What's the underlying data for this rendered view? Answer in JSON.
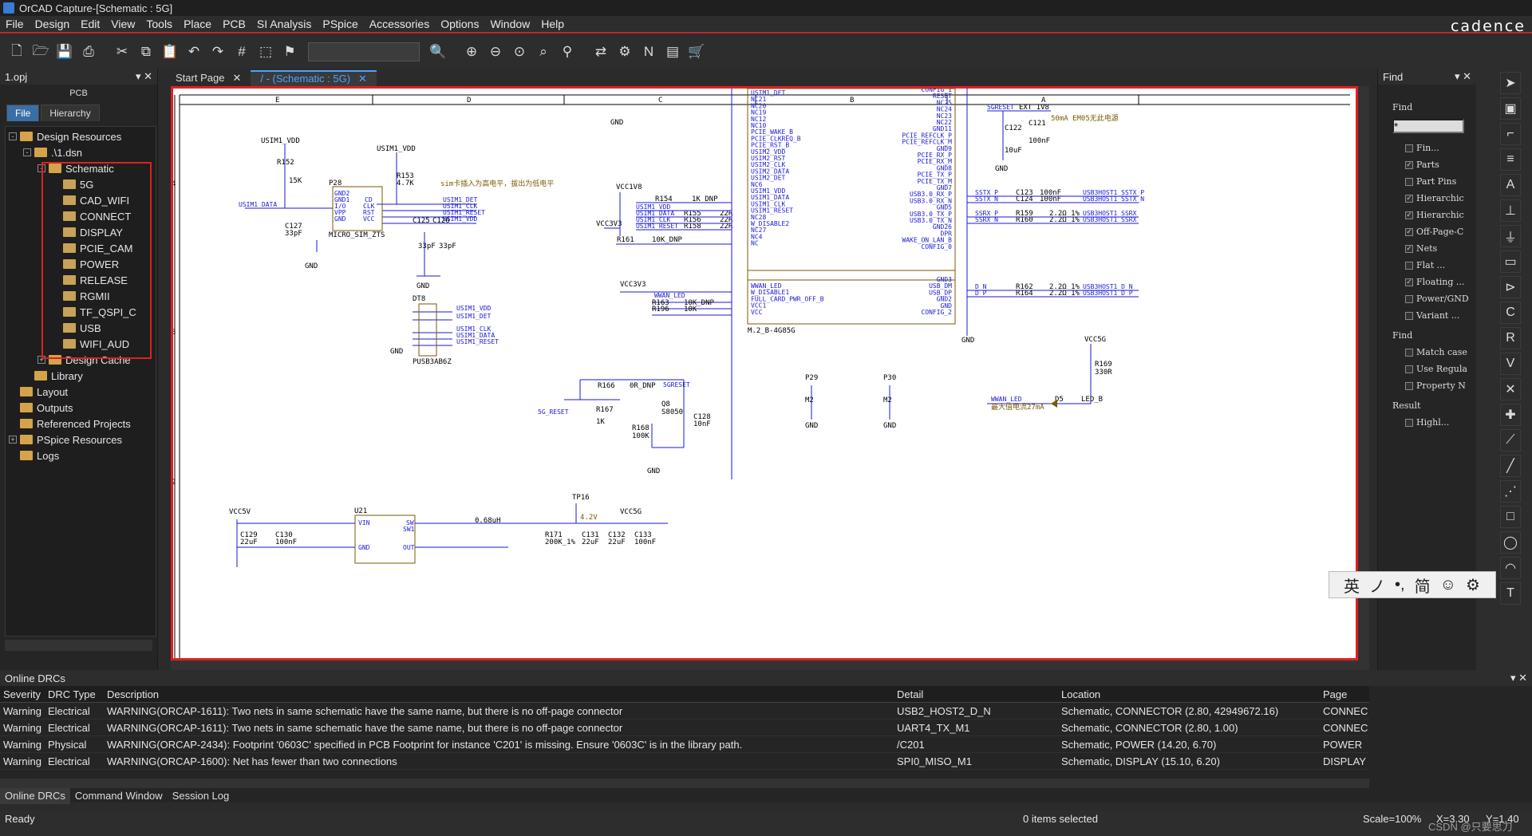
{
  "window": {
    "title": "OrCAD Capture-[Schematic : 5G]",
    "brand": "cadence"
  },
  "menu": [
    "File",
    "Design",
    "Edit",
    "View",
    "Tools",
    "Place",
    "PCB",
    "SI Analysis",
    "PSpice",
    "Accessories",
    "Options",
    "Window",
    "Help"
  ],
  "left_panel": {
    "title": "1.opj",
    "subtitle": "PCB",
    "tabs": [
      "File",
      "Hierarchy"
    ],
    "tree": [
      {
        "label": "Design Resources",
        "level": 1,
        "exp": "-"
      },
      {
        "label": ".\\1.dsn",
        "level": 2,
        "exp": "-"
      },
      {
        "label": "Schematic",
        "level": 3,
        "exp": "-"
      },
      {
        "label": "5G",
        "level": 4
      },
      {
        "label": "CAD_WIFI",
        "level": 4
      },
      {
        "label": "CONNECT",
        "level": 4
      },
      {
        "label": "DISPLAY",
        "level": 4
      },
      {
        "label": "PCIE_CAM",
        "level": 4
      },
      {
        "label": "POWER",
        "level": 4
      },
      {
        "label": "RELEASE",
        "level": 4
      },
      {
        "label": "RGMII",
        "level": 4
      },
      {
        "label": "TF_QSPI_C",
        "level": 4
      },
      {
        "label": "USB",
        "level": 4
      },
      {
        "label": "WIFI_AUD",
        "level": 4
      },
      {
        "label": "Design Cache",
        "level": 3,
        "exp": "+"
      },
      {
        "label": "Library",
        "level": 2
      },
      {
        "label": "Layout",
        "level": 1
      },
      {
        "label": "Outputs",
        "level": 1
      },
      {
        "label": "Referenced Projects",
        "level": 1
      },
      {
        "label": "PSpice Resources",
        "level": 1,
        "exp": "+"
      },
      {
        "label": "Logs",
        "level": 1
      }
    ]
  },
  "doc_tabs": [
    {
      "label": "Start Page"
    },
    {
      "label": "/ - (Schematic : 5G)",
      "active": true
    }
  ],
  "schematic": {
    "zones": [
      "E",
      "D",
      "C",
      "B",
      "A"
    ],
    "row_marks": [
      "4",
      "3",
      "2"
    ],
    "parts": {
      "p28": {
        "ref": "P28",
        "value": "MICRO_SIM_ZTS",
        "pins_l": [
          "GND2",
          "GND1",
          "I/O",
          "VPP",
          "GND"
        ],
        "pins_r": [
          "CD",
          "CLK",
          "RST",
          "VCC"
        ]
      },
      "dt8": {
        "ref": "DT8",
        "value": "PUSB3AB6Z"
      },
      "u_m2": {
        "value": "M.2_B-4G85G"
      },
      "u21": {
        "ref": "U21",
        "pins": [
          "VIN",
          "GND",
          "SW",
          "SW1",
          "OUT"
        ]
      },
      "q8": {
        "ref": "Q8",
        "value": "S8050"
      }
    },
    "nets": [
      "USIM1_VDD",
      "USIM1_DATA",
      "USIM1_DET",
      "USIM1_CLK",
      "USIM1_RESET",
      "VCC1V8",
      "VCC3V3",
      "WWAN_LED",
      "5G_RESET",
      "5GRESET",
      "EXT_1V8",
      "VCC5G",
      "VCC5V",
      "GND",
      "SSTX_P",
      "SSTX_N",
      "SSRX_P",
      "SSRX_N",
      "D_N",
      "D_P",
      "USB3HOST1_SSTX_P",
      "USB3HOST1_SSTX_N",
      "USB3HOST1_SSRX",
      "USB3HOST1_D_N",
      "USB3HOST1_D_P"
    ],
    "labels": {
      "r152": "R152",
      "r152v": "15K",
      "r153": "R153",
      "r153v": "4.7K",
      "c127": "C127",
      "c127v": "33pF",
      "c125": "C125",
      "c126": "C126",
      "c33a": "33pF",
      "c33b": "33pF",
      "note1": "sim卡插入为高电平，拔出为低电平",
      "r154": "R154",
      "r154v": "1K_DNP",
      "r155": "R155",
      "r156": "R156",
      "r158": "R158",
      "r22": "22R",
      "r161": "R161",
      "r161v": "10K_DNP",
      "r163": "R163",
      "r163v": "10K_DNP",
      "r196": "R196",
      "r196v": "10K",
      "r166": "R166",
      "r166v": "0R_DNP",
      "r167": "R167",
      "r167v": "1K",
      "r168": "R168",
      "r168v": "100K",
      "c128": "C128",
      "c128v": "10nF",
      "c122": "C122",
      "c122v": "10uF",
      "c121": "C121",
      "c121v": "100nF",
      "note2": "50mA EM05无此电源",
      "c123": "C123",
      "c124": "C124",
      "c100n": "100nF",
      "r159": "R159",
      "r160": "R160",
      "r162": "R162",
      "r164": "R164",
      "r22p": "2.2Ω_1%",
      "p29": "P29",
      "p30": "P30",
      "m2": "M2",
      "r169": "R169",
      "r169v": "330R",
      "d5": "D5",
      "d5v": "LED_B",
      "note3": "最大值电流27mA",
      "tp16": "TP16",
      "c129": "C129",
      "c129v": "22uF",
      "c130": "C130",
      "c130v": "100nF",
      "l068": "0.68uH",
      "r171": "R171",
      "r171v": "200K_1%",
      "c131": "C131",
      "c131v": "22uF",
      "c132": "C132",
      "c132v": "22uF",
      "c133": "C133",
      "c133v": "100nF",
      "v42": "4.2V",
      "m2l": [
        "USIM1_DET",
        "NC21",
        "NC20",
        "NC19",
        "NC12",
        "NC10",
        "PCIE_WAKE_B",
        "PCIE_CLKREQ_B",
        "PCIE_RST_B",
        "USIM2_VDD",
        "USIM2_RST",
        "USIM2_CLK",
        "USIM2_DATA",
        "USIM2_DET",
        "NC6",
        "USIM1_VDD",
        "USIM1_DATA",
        "USIM1_CLK",
        "USIM1_RESET",
        "NC28",
        "W_DISABLE2",
        "NC27",
        "NC4",
        "NC"
      ],
      "m2r": [
        "CONFIG_1",
        "RESET",
        "NC25",
        "NC24",
        "NC23",
        "NC22",
        "GND11",
        "PCIE_REFCLK_P",
        "PCIE_REFCLK_M",
        "GND9",
        "PCIE_RX_P",
        "PCIE_RX_M",
        "GND8",
        "PCIE_TX_P",
        "PCIE_TX_M",
        "GND7",
        "USB3.0_RX_P",
        "USB3.0_RX_N",
        "GND5",
        "USB3.0_TX_P",
        "USB3.0_TX_N",
        "GND26",
        "DPR",
        "WAKE_ON_LAN_B",
        "CONFIG_0"
      ],
      "m2lb": [
        "WWAN_LED",
        "W_DISABLE1",
        "FULL_CARD_PWR_OFF_B",
        "VCC1",
        "VCC"
      ],
      "m2rb": [
        "GND3",
        "USB_DM",
        "USB_DP",
        "GND2",
        "GND",
        "CONFIG_2"
      ]
    }
  },
  "find_panel": {
    "title": "Find",
    "label1": "Find",
    "input_value": "*",
    "items": [
      {
        "label": "Fin...",
        "checked": false
      },
      {
        "label": "Parts",
        "checked": true
      },
      {
        "label": "Part Pins",
        "checked": false
      },
      {
        "label": "Hierarchic",
        "checked": true
      },
      {
        "label": "Hierarchic",
        "checked": true
      },
      {
        "label": "Off-Page-C",
        "checked": true
      },
      {
        "label": "Nets",
        "checked": true
      },
      {
        "label": "Flat ...",
        "checked": false
      },
      {
        "label": "Floating ...",
        "checked": true
      },
      {
        "label": "Power/GND",
        "checked": false
      },
      {
        "label": "Variant ...",
        "checked": false
      }
    ],
    "label2": "Find",
    "items2": [
      {
        "label": "Match case",
        "checked": false
      },
      {
        "label": "Use Regula",
        "checked": false
      },
      {
        "label": "Property N",
        "checked": false
      }
    ],
    "label3": "Result",
    "items3": [
      {
        "label": "Highl...",
        "checked": false
      }
    ]
  },
  "ime": {
    "items": [
      "英",
      "ノ",
      "•,",
      "简",
      "☺",
      "⚙"
    ]
  },
  "bottom_panel": {
    "title": "Online DRCs",
    "columns": [
      "Severity",
      "DRC Type",
      "Description",
      "Detail",
      "Location",
      "Page"
    ],
    "rows": [
      [
        "Warning",
        "Electrical",
        "WARNING(ORCAP-1611): Two nets in same schematic have the same name, but there is no off-page connector",
        "USB2_HOST2_D_N",
        "Schematic, CONNECTOR  (2.80, 42949672.16)",
        "CONNEC"
      ],
      [
        "Warning",
        "Electrical",
        "WARNING(ORCAP-1611): Two nets in same schematic have the same name, but there is no off-page connector",
        "UART4_TX_M1",
        "Schematic, CONNECTOR  (2.80, 1.00)",
        "CONNEC"
      ],
      [
        "Warning",
        "Physical",
        "WARNING(ORCAP-2434): Footprint '0603C' specified in PCB Footprint for instance 'C201' is missing. Ensure '0603C' is in the library path.",
        "/C201",
        "Schematic, POWER  (14.20, 6.70)",
        "POWER"
      ],
      [
        "Warning",
        "Electrical",
        "WARNING(ORCAP-1600): Net has fewer than two connections",
        "SPI0_MISO_M1",
        "Schematic, DISPLAY  (15.10, 6.20)",
        "DISPLAY"
      ]
    ],
    "tabs": [
      "Online DRCs",
      "Command Window",
      "Session Log"
    ]
  },
  "status": {
    "left": "Ready",
    "center": "0 items selected",
    "scale": "Scale=100%",
    "x": "X=3.30",
    "y": "Y=1.40",
    "wm": "CSDN @只要思刀"
  }
}
